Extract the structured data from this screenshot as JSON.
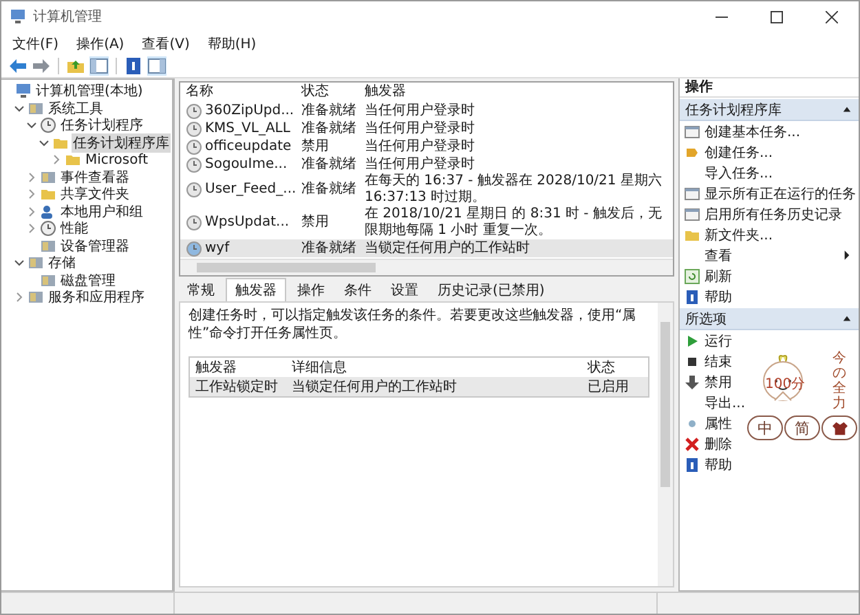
{
  "window": {
    "title": "计算机管理"
  },
  "menu": [
    "文件(F)",
    "操作(A)",
    "查看(V)",
    "帮助(H)"
  ],
  "tree": [
    {
      "label": "计算机管理(本地)",
      "kind": "computer",
      "expandable": false,
      "expanded": true,
      "selected": false,
      "children": [
        {
          "label": "系统工具",
          "kind": "tool",
          "expandable": true,
          "expanded": true,
          "selected": false,
          "children": [
            {
              "label": "任务计划程序",
              "kind": "clock",
              "expandable": true,
              "expanded": true,
              "selected": false,
              "children": [
                {
                  "label": "任务计划程序库",
                  "kind": "folder",
                  "expandable": true,
                  "expanded": true,
                  "selected": true,
                  "children": [
                    {
                      "label": "Microsoft",
                      "kind": "folder",
                      "expandable": true,
                      "expanded": false,
                      "selected": false
                    }
                  ]
                }
              ]
            },
            {
              "label": "事件查看器",
              "kind": "tool",
              "expandable": true,
              "expanded": false,
              "selected": false
            },
            {
              "label": "共享文件夹",
              "kind": "folder",
              "expandable": true,
              "expanded": false,
              "selected": false
            },
            {
              "label": "本地用户和组",
              "kind": "users",
              "expandable": true,
              "expanded": false,
              "selected": false
            },
            {
              "label": "性能",
              "kind": "clock",
              "expandable": true,
              "expanded": false,
              "selected": false
            },
            {
              "label": "设备管理器",
              "kind": "tool",
              "expandable": false,
              "expanded": false,
              "selected": false
            }
          ]
        },
        {
          "label": "存储",
          "kind": "tool",
          "expandable": true,
          "expanded": true,
          "selected": false,
          "children": [
            {
              "label": "磁盘管理",
              "kind": "tool",
              "expandable": false,
              "expanded": false,
              "selected": false
            }
          ]
        },
        {
          "label": "服务和应用程序",
          "kind": "tool",
          "expandable": true,
          "expanded": false,
          "selected": false
        }
      ]
    }
  ],
  "tasks": {
    "columns": [
      "名称",
      "状态",
      "触发器"
    ],
    "rows": [
      {
        "name": "360ZipUpd...",
        "status": "准备就绪",
        "trigger": "当任何用户登录时",
        "selected": false
      },
      {
        "name": "KMS_VL_ALL",
        "status": "准备就绪",
        "trigger": "当任何用户登录时",
        "selected": false
      },
      {
        "name": "officeupdate",
        "status": "禁用",
        "trigger": "当任何用户登录时",
        "selected": false
      },
      {
        "name": "SogouIme...",
        "status": "准备就绪",
        "trigger": "当任何用户登录时",
        "selected": false
      },
      {
        "name": "User_Feed_...",
        "status": "准备就绪",
        "trigger": "在每天的 16:37 - 触发器在 2028/10/21 星期六 16:37:13 时过期。",
        "selected": false
      },
      {
        "name": "WpsUpdat...",
        "status": "禁用",
        "trigger": "在 2018/10/21 星期日 的 8:31 时 - 触发后，无限期地每隔 1 小时 重复一次。",
        "selected": false
      },
      {
        "name": "wyf",
        "status": "准备就绪",
        "trigger": "当锁定任何用户的工作站时",
        "selected": true
      }
    ]
  },
  "detail": {
    "tabs": [
      {
        "label": "常规",
        "selected": false
      },
      {
        "label": "触发器",
        "selected": true
      },
      {
        "label": "操作",
        "selected": false
      },
      {
        "label": "条件",
        "selected": false
      },
      {
        "label": "设置",
        "selected": false
      },
      {
        "label": "历史记录(已禁用)",
        "selected": false
      }
    ],
    "description": "创建任务时，可以指定触发该任务的条件。若要更改这些触发器，使用“属性”命令打开任务属性页。",
    "triggers": {
      "columns": [
        "触发器",
        "详细信息",
        "状态"
      ],
      "rows": [
        {
          "cells": [
            "工作站锁定时",
            "当锁定任何用户的工作站时",
            "已启用"
          ],
          "selected": true
        }
      ]
    }
  },
  "actions": {
    "title": "操作",
    "sections": [
      {
        "title": "任务计划程序库",
        "expanded": true,
        "items": [
          {
            "label": "创建基本任务...",
            "kind": "wizard",
            "submenu": false
          },
          {
            "label": "创建任务...",
            "kind": "task",
            "submenu": false
          },
          {
            "label": "导入任务...",
            "kind": "plain",
            "submenu": false
          },
          {
            "label": "显示所有正在运行的任务",
            "kind": "list",
            "submenu": false
          },
          {
            "label": "启用所有任务历史记录",
            "kind": "list",
            "submenu": false
          },
          {
            "label": "新文件夹...",
            "kind": "folder",
            "submenu": false
          },
          {
            "label": "查看",
            "kind": "plain",
            "submenu": true
          },
          {
            "label": "刷新",
            "kind": "refresh",
            "submenu": false
          },
          {
            "label": "帮助",
            "kind": "help",
            "submenu": false
          }
        ]
      },
      {
        "title": "所选项",
        "expanded": true,
        "items": [
          {
            "label": "运行",
            "kind": "run",
            "submenu": false
          },
          {
            "label": "结束",
            "kind": "stop",
            "submenu": false
          },
          {
            "label": "禁用",
            "kind": "disable",
            "submenu": false
          },
          {
            "label": "导出...",
            "kind": "plain",
            "submenu": false
          },
          {
            "label": "属性",
            "kind": "properties",
            "submenu": false
          },
          {
            "label": "删除",
            "kind": "delete",
            "submenu": false
          },
          {
            "label": "帮助",
            "kind": "help",
            "submenu": false
          }
        ]
      }
    ]
  },
  "ime": {
    "badge": "100分",
    "slogan": "今の全力",
    "buttons": [
      "中",
      "简"
    ]
  }
}
